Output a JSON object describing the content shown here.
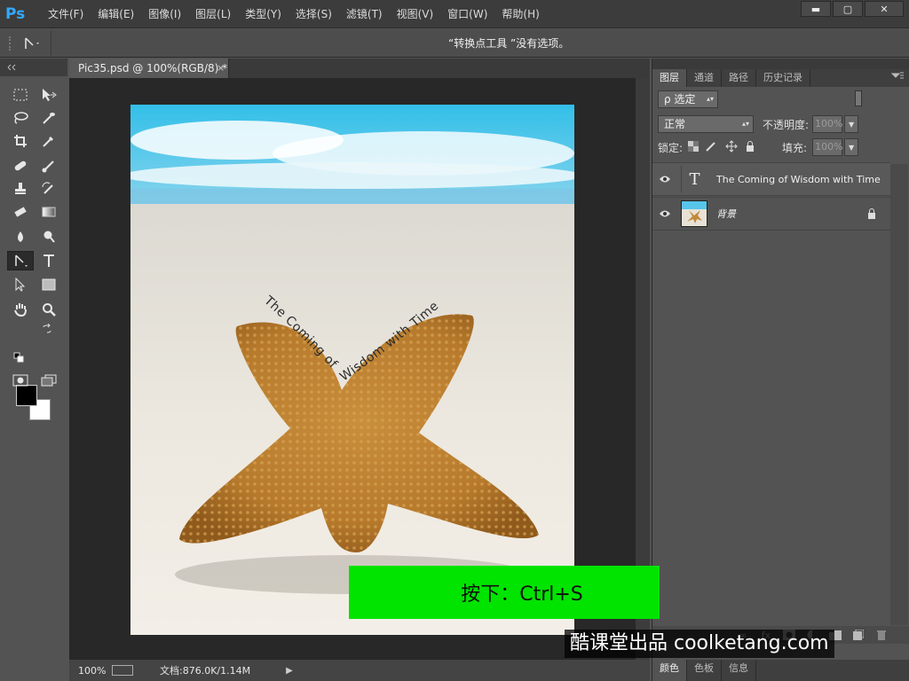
{
  "app": {
    "logo": "Ps",
    "menus": [
      "文件(F)",
      "编辑(E)",
      "图像(I)",
      "图层(L)",
      "类型(Y)",
      "选择(S)",
      "滤镜(T)",
      "视图(V)",
      "窗口(W)",
      "帮助(H)"
    ],
    "window_controls": {
      "minimize": "▬",
      "maximize": "▢",
      "close": "✕"
    }
  },
  "options_bar": {
    "tool_icon": "convert-point-icon",
    "message": "“转换点工具 ”没有选项。"
  },
  "document": {
    "tab_title": "Pic35.psd @ 100%(RGB/8) *",
    "tab_close": "×",
    "curved_text": "The Coming of Wisdom with Time"
  },
  "status_bar": {
    "zoom": "100%",
    "doc_size": "文档:876.0K/1.14M",
    "arrow": "▶"
  },
  "overlay": {
    "key_hint": "按下：Ctrl+S",
    "watermark": "酷课堂出品 coolketang.com"
  },
  "layers_panel": {
    "tabs": [
      "图层",
      "通道",
      "路径",
      "历史记录"
    ],
    "active_tab": "图层",
    "filter_label": "ρ 选定",
    "blend_mode": "正常",
    "opacity_label": "不透明度:",
    "opacity_value": "100%",
    "lock_label": "锁定:",
    "fill_label": "填充:",
    "fill_value": "100%",
    "layers": [
      {
        "name": "The Coming of Wisdom with Time",
        "type": "text",
        "thumb": "T"
      },
      {
        "name": "背景",
        "type": "image",
        "locked": true
      }
    ]
  },
  "color_panel": {
    "tabs": [
      "颜色",
      "色板",
      "信息"
    ]
  },
  "colors": {
    "foreground": "#000000",
    "background": "#ffffff",
    "key_hint_bg": "#00e400",
    "ps_blue": "#31a8ff"
  }
}
